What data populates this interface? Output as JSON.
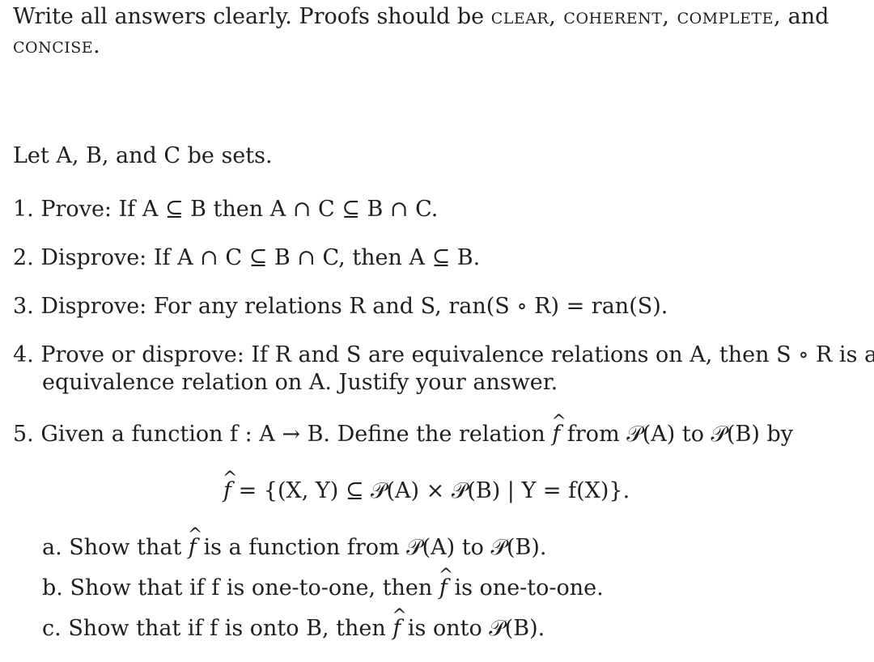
{
  "header": {
    "line1_plain": "Write all answers clearly.  Proofs should be ",
    "line1_sc": "clear, coherent, complete,",
    "line1_end": " and",
    "line2_sc": "concise."
  },
  "intro": "Let A, B, and C be sets.",
  "problems": [
    {
      "num": "1.",
      "text": "Prove: If A ⊆ B then A ∩ C ⊆ B ∩ C."
    },
    {
      "num": "2.",
      "text": "Disprove: If A ∩ C ⊆ B ∩ C, then A ⊆ B."
    },
    {
      "num": "3.",
      "text": "Disprove: For any relations R and S, ran(S ∘ R) = ran(S)."
    },
    {
      "num": "4.",
      "text_line1": "Prove or disprove: If R and S are equivalence relations on A, then S ∘ R is an",
      "text_line2": "equivalence relation on A. Justify your answer."
    },
    {
      "num": "5.",
      "text_pre": "Given a function f : A → B. Define the relation ",
      "fhat": "f",
      "text_post": " from 𝒫(A) to 𝒫(B) by",
      "display_eq_pre": "f",
      "display_eq_post": " = {(X, Y) ⊆ 𝒫(A) × 𝒫(B)  |  Y = f(X)}.",
      "parts": [
        {
          "label": "a.",
          "pre": "Show that ",
          "post": " is a function from 𝒫(A) to 𝒫(B)."
        },
        {
          "label": "b.",
          "pre": "Show that if f is one-to-one, then ",
          "post": " is one-to-one."
        },
        {
          "label": "c.",
          "pre": "Show that if f is onto B, then ",
          "post": " is onto 𝒫(B)."
        }
      ]
    }
  ],
  "hat_symbol": "^"
}
